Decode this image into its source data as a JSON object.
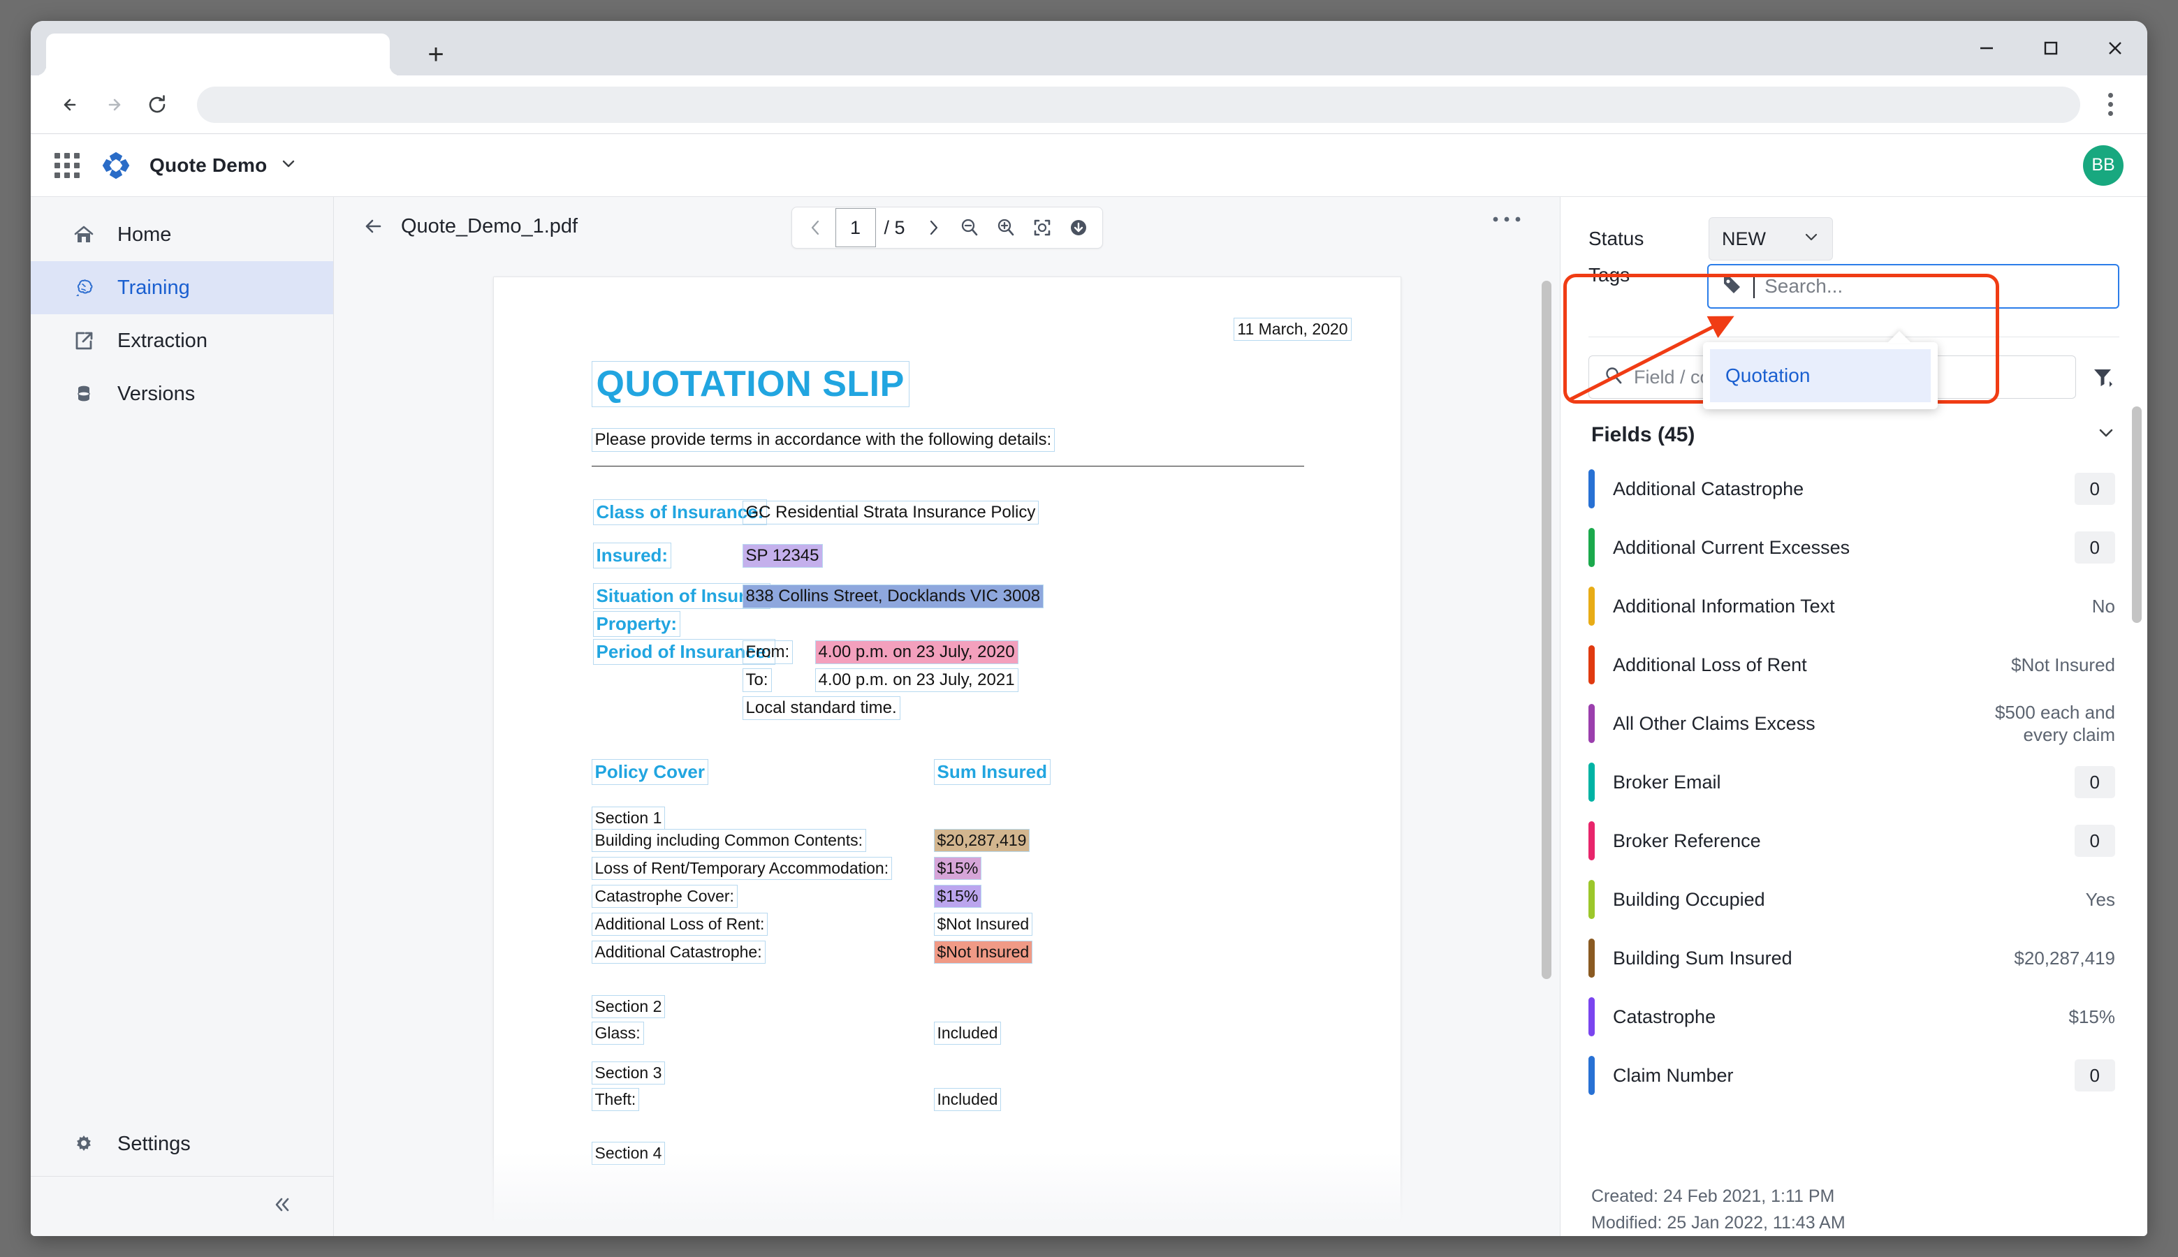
{
  "browser": {
    "tab_title": "",
    "new_tab_label": "+",
    "omnibox_value": "",
    "controls": {
      "minimize": "minimize-icon",
      "maximize": "maximize-icon",
      "close": "close-icon"
    }
  },
  "app_header": {
    "title": "Quote Demo",
    "avatar_initials": "BB",
    "brand_color": "#2a6cc7"
  },
  "sidebar": {
    "items": [
      {
        "label": "Home",
        "icon": "home-icon",
        "active": false
      },
      {
        "label": "Training",
        "icon": "brain-icon",
        "active": true
      },
      {
        "label": "Extraction",
        "icon": "export-icon",
        "active": false
      },
      {
        "label": "Versions",
        "icon": "database-icon",
        "active": false
      }
    ],
    "settings_label": "Settings",
    "collapse_icon": "chevron-double-left-icon"
  },
  "viewer": {
    "filename": "Quote_Demo_1.pdf",
    "back_icon": "arrow-left-icon",
    "page_current": "1",
    "page_total": "/ 5",
    "zoom_out_icon": "zoom-out-icon",
    "zoom_in_icon": "zoom-in-icon",
    "fit_icon": "fit-page-icon",
    "download_icon": "download-icon",
    "more_icon": "more-horizontal-icon"
  },
  "document": {
    "date": "11 March, 2020",
    "title": "QUOTATION SLIP",
    "intro": "Please provide terms in accordance with the following details:",
    "pairs": [
      {
        "label": "Class of Insurance:",
        "value": "GC Residential Strata Insurance Policy"
      },
      {
        "label": "Insured:",
        "value": "SP 12345"
      },
      {
        "label": "Situation of Insured",
        "label2": "Property:",
        "value": "838 Collins Street, Docklands VIC 3008"
      }
    ],
    "period": {
      "label": "Period of Insurance:",
      "from_label": "From:",
      "from_value": "4.00 p.m. on 23 July, 2020",
      "to_label": "To:",
      "to_value": "4.00 p.m. on 23 July, 2021",
      "note": "Local standard time."
    },
    "cover_header_left": "Policy Cover",
    "cover_header_right": "Sum Insured",
    "sections": [
      {
        "title": "Section 1",
        "rows": [
          {
            "label": "Building including Common Contents:",
            "value": "$20,287,419"
          },
          {
            "label": "Loss of Rent/Temporary Accommodation:",
            "value": "$15%"
          },
          {
            "label": "Catastrophe Cover:",
            "value": "$15%"
          },
          {
            "label": "Additional Loss of Rent:",
            "value": "$Not Insured"
          },
          {
            "label": "Additional Catastrophe:",
            "value": "$Not Insured"
          }
        ]
      },
      {
        "title": "Section 2",
        "rows": [
          {
            "label": "Glass:",
            "value": "Included"
          }
        ]
      },
      {
        "title": "Section 3",
        "rows": [
          {
            "label": "Theft:",
            "value": "Included"
          }
        ]
      },
      {
        "title": "Section 4",
        "rows": []
      }
    ]
  },
  "right_panel": {
    "status_label": "Status",
    "status_value": "NEW",
    "tags_label": "Tags",
    "tag_search_placeholder": "Search...",
    "tag_icon": "tag-icon",
    "tag_dropdown_options": [
      "Quotation"
    ],
    "field_search_placeholder": "Field / column name containment",
    "search_icon": "search-icon",
    "filter_icon": "filter-icon",
    "fields_title": "Fields (45)",
    "collapse_icon": "chevron-down-icon",
    "fields": [
      {
        "name": "Additional Catastrophe",
        "value": "0",
        "chip": true,
        "color": "#2871d4"
      },
      {
        "name": "Additional Current Excesses",
        "value": "0",
        "chip": true,
        "color": "#1ba94c"
      },
      {
        "name": "Additional Information Text",
        "value": "No",
        "chip": false,
        "color": "#e8ac16"
      },
      {
        "name": "Additional Loss of Rent",
        "value": "$Not Insured",
        "chip": false,
        "color": "#e03a10"
      },
      {
        "name": "All Other Claims Excess",
        "value": "$500 each and every claim",
        "chip": false,
        "color": "#9b3fad"
      },
      {
        "name": "Broker Email",
        "value": "0",
        "chip": true,
        "color": "#00b3a4"
      },
      {
        "name": "Broker Reference",
        "value": "0",
        "chip": true,
        "color": "#e8256b"
      },
      {
        "name": "Building Occupied",
        "value": "Yes",
        "chip": false,
        "color": "#9cc72b"
      },
      {
        "name": "Building Sum Insured",
        "value": "$20,287,419",
        "chip": false,
        "color": "#8a5a22"
      },
      {
        "name": "Catastrophe",
        "value": "$15%",
        "chip": false,
        "color": "#7a45ef"
      },
      {
        "name": "Claim Number",
        "value": "0",
        "chip": true,
        "color": "#2871d4"
      }
    ],
    "created": "Created: 24 Feb 2021, 1:11 PM",
    "modified": "Modified: 25 Jan 2022, 11:43 AM"
  },
  "annotation": {
    "color": "#f03c14",
    "shape": "rounded-box-with-arrow"
  }
}
